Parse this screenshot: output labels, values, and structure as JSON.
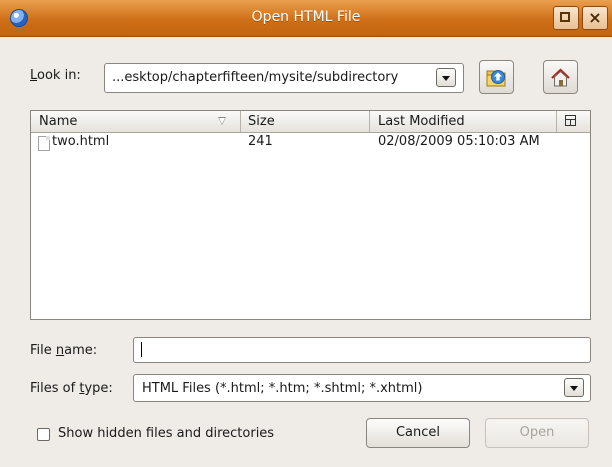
{
  "window": {
    "title": "Open HTML File",
    "icons": {
      "app": "app-globe-icon",
      "maximize": "maximize-icon",
      "close": "close-icon"
    }
  },
  "look_in": {
    "label_prefix": "L",
    "label_rest": "ook in:",
    "value": "...esktop/chapterfifteen/mysite/subdirectory",
    "up_folder_icon": "up-folder-icon",
    "home_icon": "home-icon"
  },
  "table": {
    "columns": [
      "Name",
      "Size",
      "Last Modified"
    ],
    "rows": [
      {
        "name": "two.html",
        "size": "241",
        "modified": "02/08/2009 05:10:03 AM"
      }
    ]
  },
  "file_name": {
    "label_before": "File ",
    "label_u": "n",
    "label_after": "ame:",
    "value": ""
  },
  "files_of_type": {
    "label_before": "Files of ",
    "label_u": "t",
    "label_after": "ype:",
    "value": "HTML Files (*.html; *.htm; *.shtml; *.xhtml)"
  },
  "show_hidden": {
    "label": "Show hidden files and directories",
    "checked": false
  },
  "buttons": {
    "cancel": "Cancel",
    "open": "Open"
  }
}
